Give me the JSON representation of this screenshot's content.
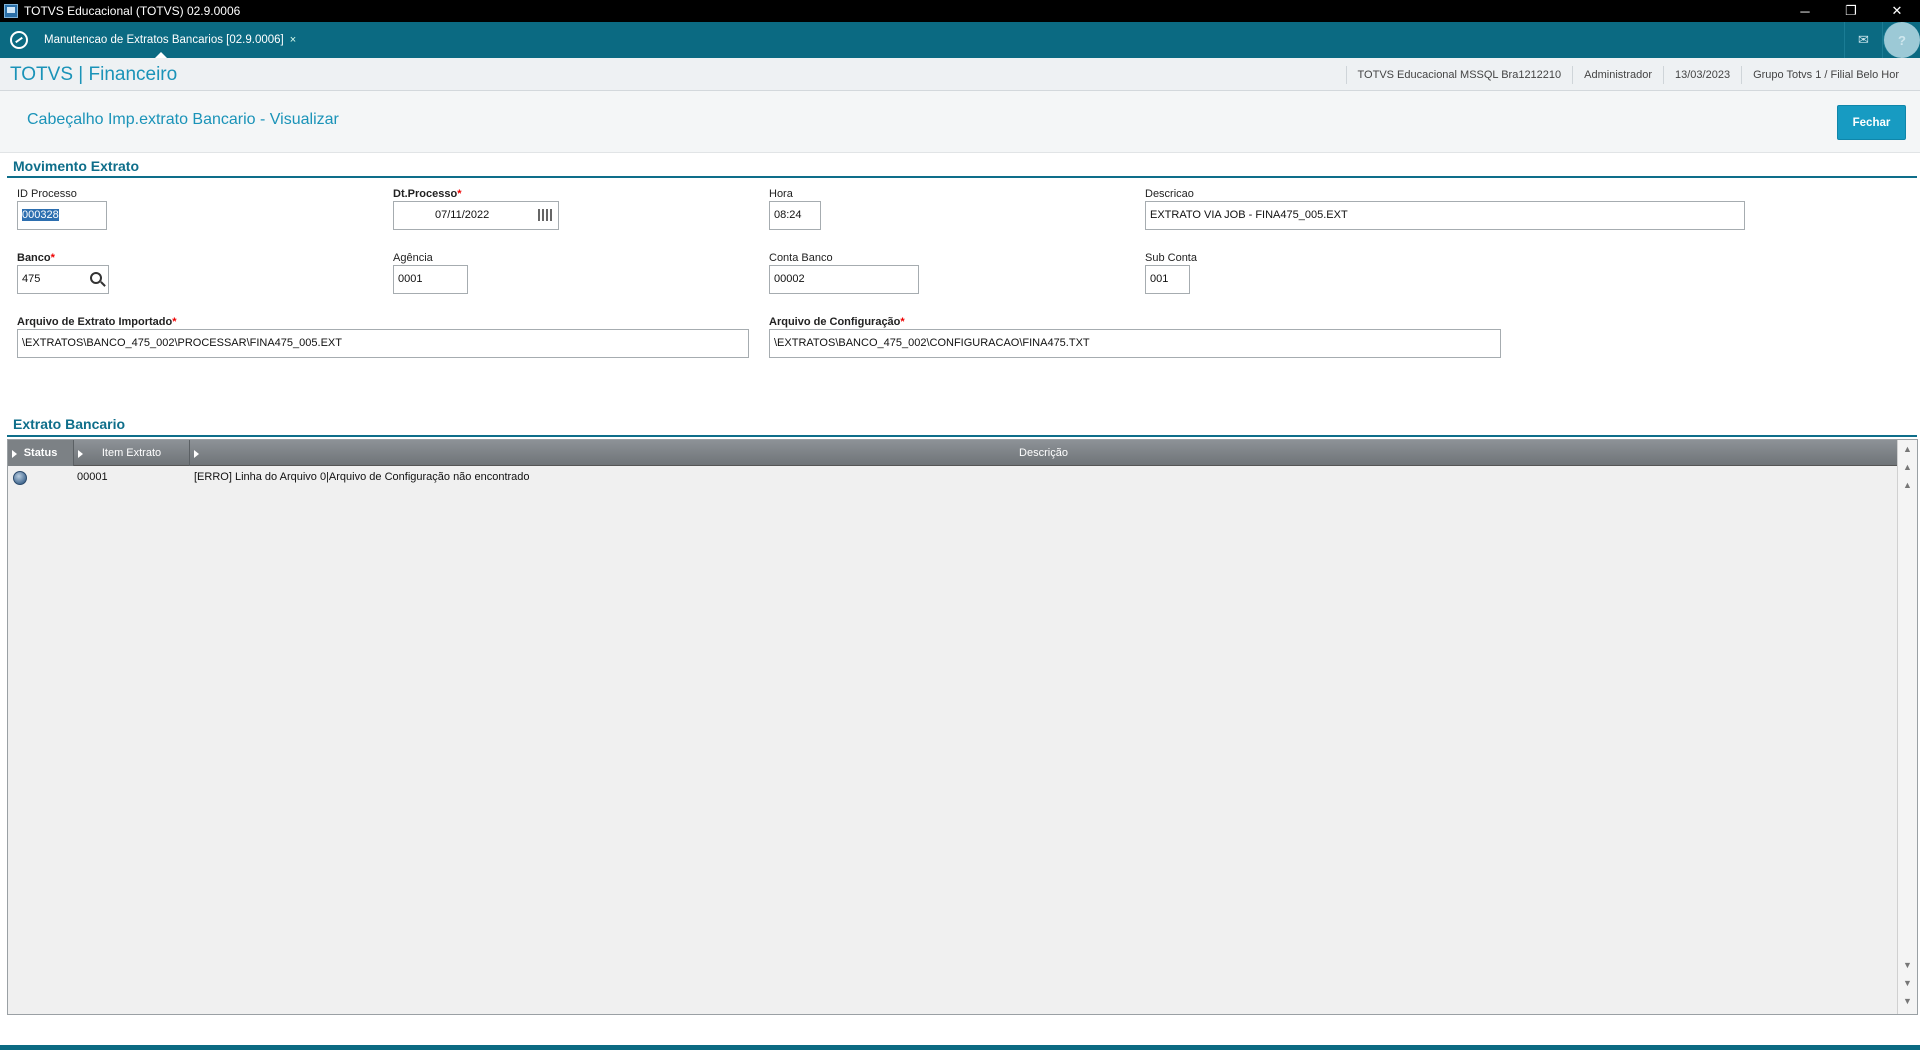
{
  "window": {
    "title": "TOTVS Educacional (TOTVS) 02.9.0006",
    "controls": [
      "─",
      "❐",
      "✕"
    ]
  },
  "tabbar": {
    "tab_label": "Manutencao de Extratos Bancarios [02.9.0006]",
    "tab_close": "×",
    "mail_icon": "✉",
    "help_icon": "?"
  },
  "header": {
    "brand": "TOTVS | Financeiro",
    "environment": "TOTVS Educacional MSSQL Bra1212210",
    "user": "Administrador",
    "date": "13/03/2023",
    "branch": "Grupo Totvs 1 / Filial Belo Hor"
  },
  "page": {
    "title": "Cabeçalho Imp.extrato Bancario - Visualizar",
    "close_button": "Fechar"
  },
  "movimento": {
    "section_title": "Movimento Extrato",
    "id_processo": {
      "label": "ID Processo",
      "value": "000328"
    },
    "dt_processo": {
      "label": "Dt.Processo",
      "value": "07/11/2022"
    },
    "hora": {
      "label": "Hora",
      "value": "08:24"
    },
    "descricao": {
      "label": "Descricao",
      "value": "EXTRATO VIA JOB - FINA475_005.EXT"
    },
    "banco": {
      "label": "Banco",
      "value": "475"
    },
    "agencia": {
      "label": "Agência",
      "value": "0001"
    },
    "conta_banco": {
      "label": "Conta Banco",
      "value": "00002"
    },
    "sub_conta": {
      "label": "Sub Conta",
      "value": "001"
    },
    "arquivo_extrato": {
      "label": "Arquivo de Extrato Importado",
      "value": "\\EXTRATOS\\BANCO_475_002\\PROCESSAR\\FINA475_005.EXT"
    },
    "arquivo_config": {
      "label": "Arquivo de Configuração",
      "value": "\\EXTRATOS\\BANCO_475_002\\CONFIGURACAO\\FINA475.TXT"
    },
    "required_mark": "*"
  },
  "extrato": {
    "section_title": "Extrato Bancario",
    "columns": [
      "Status",
      "Item Extrato",
      "Descrição"
    ],
    "rows": [
      {
        "status": "blue",
        "item": "00001",
        "descricao": "[ERRO] Linha do Arquivo 0|Arquivo de Configuração não encontrado"
      }
    ]
  }
}
